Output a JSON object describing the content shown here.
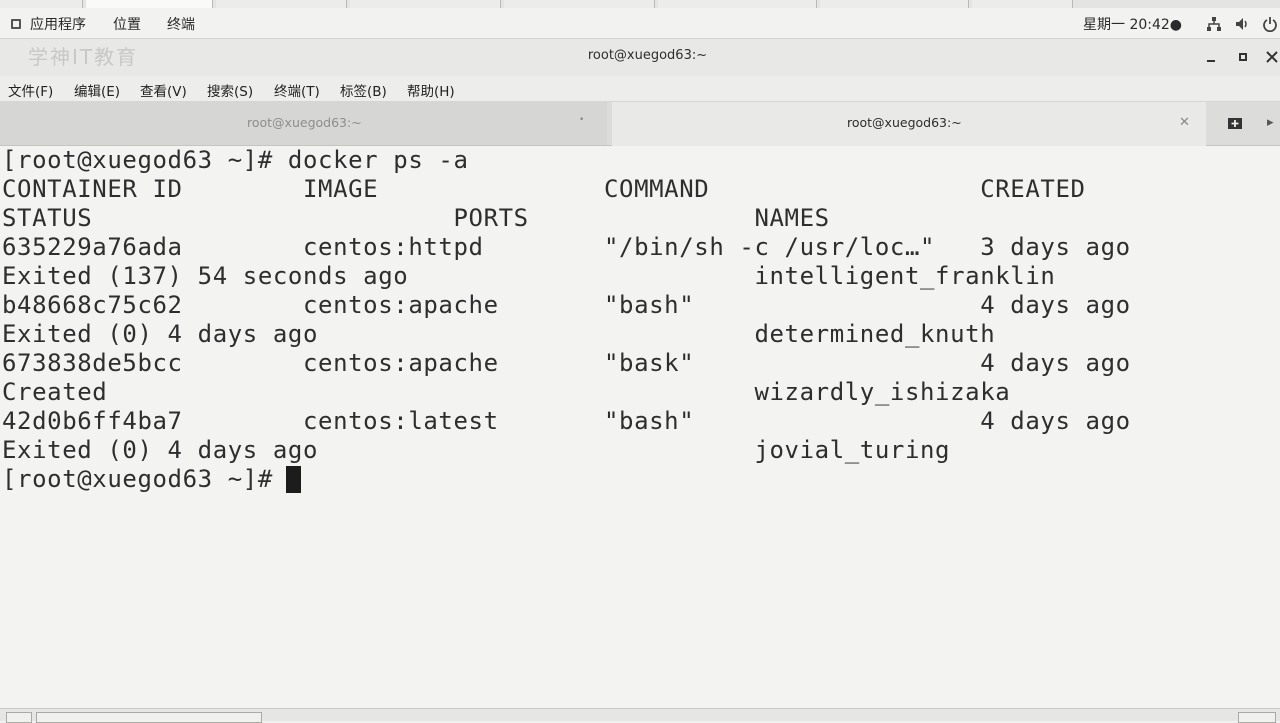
{
  "gnome": {
    "applications": "应用程序",
    "places": "位置",
    "terminal": "终端",
    "clock": "星期一 20:42●"
  },
  "window": {
    "title": "root@xuegod63:~",
    "watermark": "学神IT教育"
  },
  "menu": {
    "file": "文件(F)",
    "edit": "编辑(E)",
    "view": "查看(V)",
    "search": "搜索(S)",
    "terminal": "终端(T)",
    "tabs": "标签(B)",
    "help": "帮助(H)"
  },
  "tabs": [
    {
      "label": "root@xuegod63:~",
      "active": false
    },
    {
      "label": "root@xuegod63:~",
      "active": true
    }
  ],
  "terminal": {
    "lines": [
      "[root@xuegod63 ~]# docker ps -a",
      "CONTAINER ID        IMAGE               COMMAND                  CREATED",
      "STATUS                        PORTS               NAMES",
      "635229a76ada        centos:httpd        \"/bin/sh -c /usr/loc…\"   3 days ago",
      "Exited (137) 54 seconds ago                       intelligent_franklin",
      "b48668c75c62        centos:apache       \"bash\"                   4 days ago",
      "Exited (0) 4 days ago                             determined_knuth",
      "673838de5bcc        centos:apache       \"bask\"                   4 days ago",
      "Created                                           wizardly_ishizaka",
      "42d0b6ff4ba7        centos:latest       \"bash\"                   4 days ago",
      "Exited (0) 4 days ago                             jovial_turing",
      "[root@xuegod63 ~]# "
    ]
  }
}
